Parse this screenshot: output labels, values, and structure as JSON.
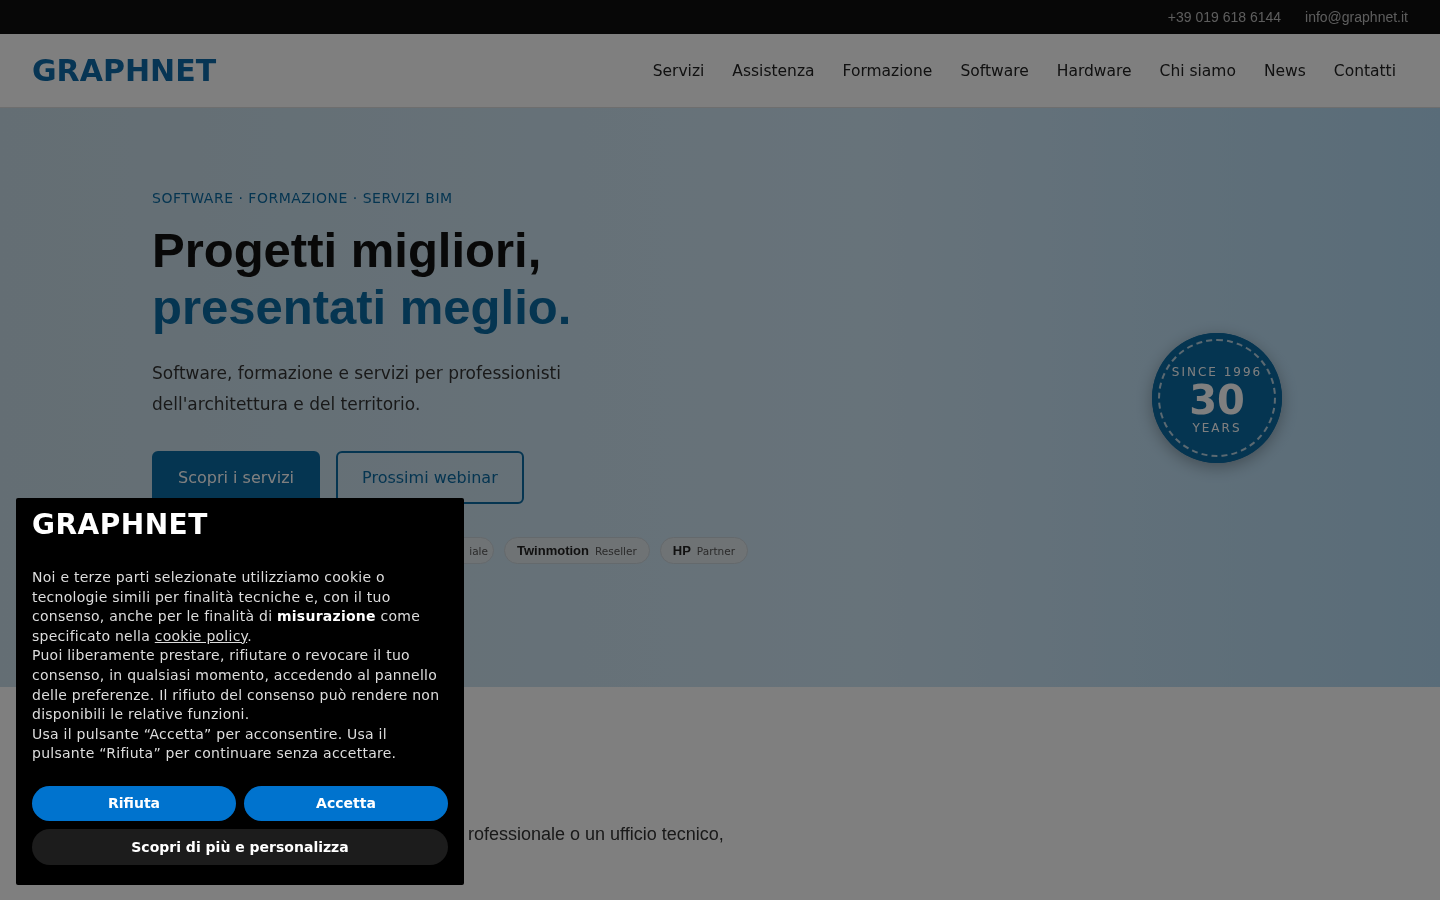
{
  "top_bar": {
    "phone": "+39 019 618 6144",
    "email": "info@graphnet.it"
  },
  "header": {
    "logo": "GRAPHNET",
    "nav": [
      {
        "label": "Servizi"
      },
      {
        "label": "Assistenza"
      },
      {
        "label": "Formazione"
      },
      {
        "label": "Software"
      },
      {
        "label": "Hardware"
      },
      {
        "label": "Chi siamo"
      },
      {
        "label": "News"
      },
      {
        "label": "Contatti"
      }
    ]
  },
  "hero": {
    "eyebrow": "SOFTWARE · FORMAZIONE · SERVIZI BIM",
    "title_line_1": "Progetti migliori,",
    "title_line_2": "presentati meglio.",
    "subtitle": "Software, formazione e servizi per professionisti dell'architettura e del territorio.",
    "buttons": [
      {
        "label": "Scopri i servizi",
        "kind": "primary"
      },
      {
        "label": "Prossimi webinar",
        "kind": "outline"
      }
    ],
    "partners": [
      {
        "role": "iale"
      },
      {
        "name": "Twinmotion",
        "role": "Reseller"
      },
      {
        "name": "HP",
        "role": "Partner"
      }
    ],
    "badge": {
      "top": "SINCE 1996",
      "number": "30",
      "bottom": "YEARS"
    }
  },
  "section": {
    "text": "rofessionale o un ufficio tecnico,"
  },
  "cookie_banner": {
    "logo": "GRAPHNET",
    "text": "Noi e terze parti selezionate utilizziamo cookie o tecnologie simili per finalità tecniche e, con il tuo consenso, anche per le finalità di **misurazione** come specificato nella",
    "link": "cookie policy",
    "text_end": ".",
    "text_2": "Puoi liberamente prestare, rifiutare o revocare il tuo consenso, in qualsiasi momento, accedendo al pannello delle preferenze. Il rifiuto del consenso può rendere non disponibili le relative funzioni.",
    "text_3": "Usa il pulsante “Accetta” per acconsentire. Usa il pulsante “Rifiuta” per continuare senza accettare.",
    "buttons": [
      {
        "label": "Rifiuta",
        "kind": "blue"
      },
      {
        "label": "Accetta",
        "kind": "blue"
      },
      {
        "label": "Scopri di più e personalizza",
        "kind": "dark"
      }
    ]
  }
}
